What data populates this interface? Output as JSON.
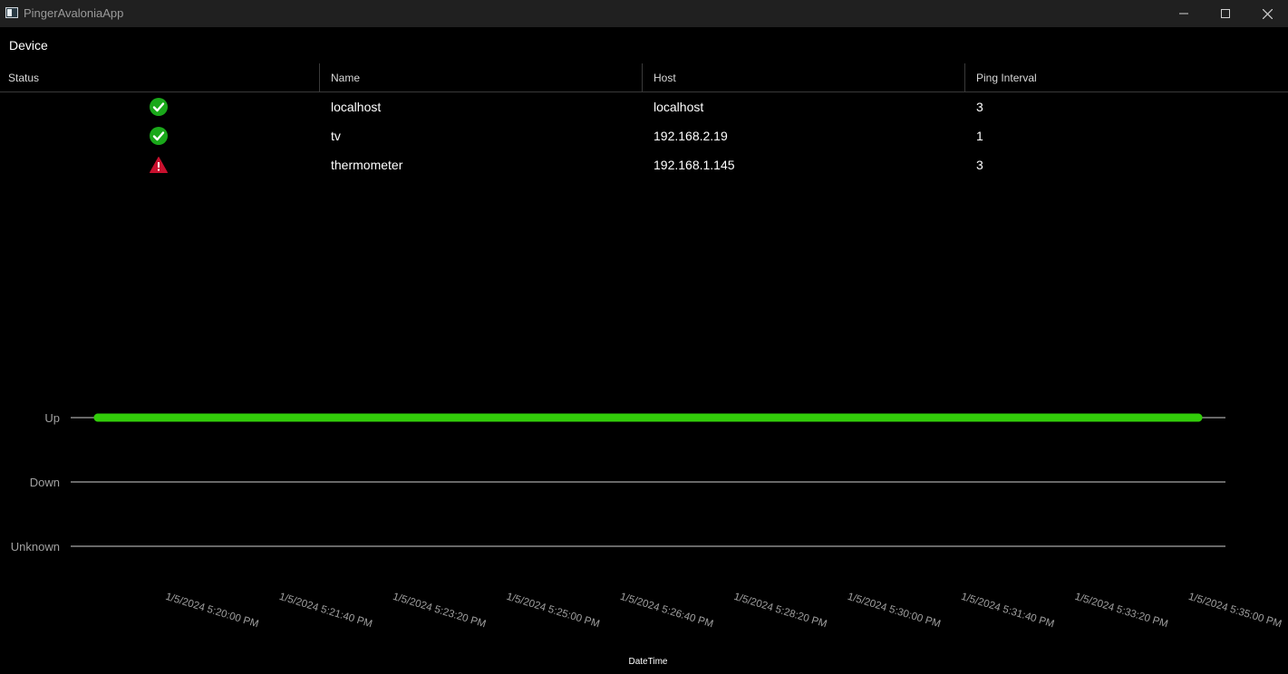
{
  "window": {
    "title": "PingerAvaloniaApp"
  },
  "menu": {
    "device_label": "Device"
  },
  "grid": {
    "columns": [
      "Status",
      "Name",
      "Host",
      "Ping Interval"
    ],
    "rows": [
      {
        "status": "up",
        "status_icon": "check-circle-icon",
        "name": "localhost",
        "host": "localhost",
        "interval": "3"
      },
      {
        "status": "up",
        "status_icon": "check-circle-icon",
        "name": "tv",
        "host": "192.168.2.19",
        "interval": "1"
      },
      {
        "status": "down",
        "status_icon": "warning-triangle-icon",
        "name": "thermometer",
        "host": "192.168.1.145",
        "interval": "3"
      }
    ]
  },
  "colors": {
    "up": "#1aa81a",
    "down": "#c8102e",
    "series": "#32cd0a"
  },
  "chart_data": {
    "type": "line",
    "xlabel": "DateTime",
    "ylabel": "",
    "y_categories": [
      "Up",
      "Down",
      "Unknown"
    ],
    "x_ticks": [
      "1/5/2024 5:20:00 PM",
      "1/5/2024 5:21:40 PM",
      "1/5/2024 5:23:20 PM",
      "1/5/2024 5:25:00 PM",
      "1/5/2024 5:26:40 PM",
      "1/5/2024 5:28:20 PM",
      "1/5/2024 5:30:00 PM",
      "1/5/2024 5:31:40 PM",
      "1/5/2024 5:33:20 PM",
      "1/5/2024 5:35:00 PM"
    ],
    "xlim": [
      "1/5/2024 5:20:00 PM",
      "1/5/2024 5:35:00 PM"
    ],
    "series": [
      {
        "values": [
          {
            "x": "1/5/2024 5:20:00 PM",
            "y": "Up"
          },
          {
            "x": "1/5/2024 5:21:40 PM",
            "y": "Up"
          },
          {
            "x": "1/5/2024 5:23:20 PM",
            "y": "Up"
          },
          {
            "x": "1/5/2024 5:25:00 PM",
            "y": "Up"
          },
          {
            "x": "1/5/2024 5:26:40 PM",
            "y": "Up"
          },
          {
            "x": "1/5/2024 5:28:20 PM",
            "y": "Up"
          },
          {
            "x": "1/5/2024 5:30:00 PM",
            "y": "Up"
          },
          {
            "x": "1/5/2024 5:31:40 PM",
            "y": "Up"
          },
          {
            "x": "1/5/2024 5:33:20 PM",
            "y": "Up"
          },
          {
            "x": "1/5/2024 5:35:00 PM",
            "y": "Up"
          }
        ]
      }
    ],
    "grid": true,
    "legend": "none"
  }
}
